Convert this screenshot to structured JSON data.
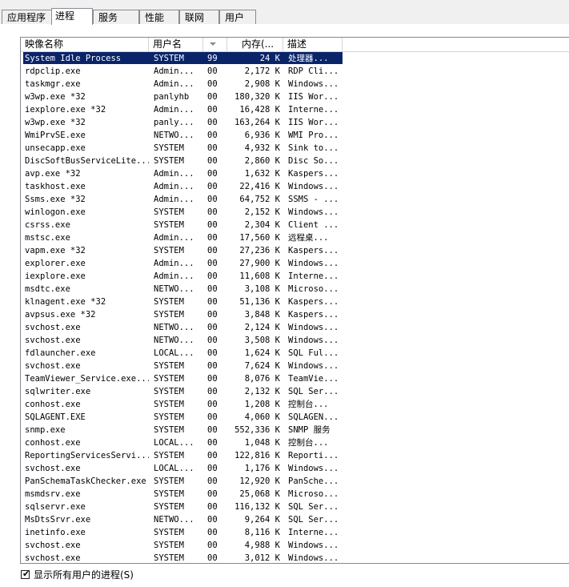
{
  "tabs": [
    {
      "label": "应用程序",
      "active": false
    },
    {
      "label": "进程",
      "active": true
    },
    {
      "label": "服务",
      "active": false
    },
    {
      "label": "性能",
      "active": false
    },
    {
      "label": "联网",
      "active": false
    },
    {
      "label": "用户",
      "active": false
    }
  ],
  "columns": {
    "name": "映像名称",
    "user": "用户名",
    "cpu": "",
    "memory": "内存(...",
    "description": "描述"
  },
  "processes": [
    {
      "name": "System Idle Process",
      "user": "SYSTEM",
      "cpu": "99",
      "memory": "24 K",
      "description": "处理器..."
    },
    {
      "name": "rdpclip.exe",
      "user": "Admin...",
      "cpu": "00",
      "memory": "2,172 K",
      "description": "RDP Cli..."
    },
    {
      "name": "taskmgr.exe",
      "user": "Admin...",
      "cpu": "00",
      "memory": "2,908 K",
      "description": "Windows..."
    },
    {
      "name": "w3wp.exe *32",
      "user": "panlyhb",
      "cpu": "00",
      "memory": "180,320 K",
      "description": "IIS Wor..."
    },
    {
      "name": "iexplore.exe *32",
      "user": "Admin...",
      "cpu": "00",
      "memory": "16,428 K",
      "description": "Interne..."
    },
    {
      "name": "w3wp.exe *32",
      "user": "panly...",
      "cpu": "00",
      "memory": "163,264 K",
      "description": "IIS Wor..."
    },
    {
      "name": "WmiPrvSE.exe",
      "user": "NETWO...",
      "cpu": "00",
      "memory": "6,936 K",
      "description": "WMI Pro..."
    },
    {
      "name": "unsecapp.exe",
      "user": "SYSTEM",
      "cpu": "00",
      "memory": "4,932 K",
      "description": "Sink to..."
    },
    {
      "name": "DiscSoftBusServiceLite...",
      "user": "SYSTEM",
      "cpu": "00",
      "memory": "2,860 K",
      "description": "Disc So..."
    },
    {
      "name": "avp.exe *32",
      "user": "Admin...",
      "cpu": "00",
      "memory": "1,632 K",
      "description": "Kaspers..."
    },
    {
      "name": "taskhost.exe",
      "user": "Admin...",
      "cpu": "00",
      "memory": "22,416 K",
      "description": "Windows..."
    },
    {
      "name": "Ssms.exe *32",
      "user": "Admin...",
      "cpu": "00",
      "memory": "64,752 K",
      "description": "SSMS - ..."
    },
    {
      "name": "winlogon.exe",
      "user": "SYSTEM",
      "cpu": "00",
      "memory": "2,152 K",
      "description": "Windows..."
    },
    {
      "name": "csrss.exe",
      "user": "SYSTEM",
      "cpu": "00",
      "memory": "2,304 K",
      "description": "Client ..."
    },
    {
      "name": "mstsc.exe",
      "user": "Admin...",
      "cpu": "00",
      "memory": "17,560 K",
      "description": "远程桌..."
    },
    {
      "name": "vapm.exe *32",
      "user": "SYSTEM",
      "cpu": "00",
      "memory": "27,236 K",
      "description": "Kaspers..."
    },
    {
      "name": "explorer.exe",
      "user": "Admin...",
      "cpu": "00",
      "memory": "27,900 K",
      "description": "Windows..."
    },
    {
      "name": "iexplore.exe",
      "user": "Admin...",
      "cpu": "00",
      "memory": "11,608 K",
      "description": "Interne..."
    },
    {
      "name": "msdtc.exe",
      "user": "NETWO...",
      "cpu": "00",
      "memory": "3,108 K",
      "description": "Microso..."
    },
    {
      "name": "klnagent.exe *32",
      "user": "SYSTEM",
      "cpu": "00",
      "memory": "51,136 K",
      "description": "Kaspers..."
    },
    {
      "name": "avpsus.exe *32",
      "user": "SYSTEM",
      "cpu": "00",
      "memory": "3,848 K",
      "description": "Kaspers..."
    },
    {
      "name": "svchost.exe",
      "user": "NETWO...",
      "cpu": "00",
      "memory": "2,124 K",
      "description": "Windows..."
    },
    {
      "name": "svchost.exe",
      "user": "NETWO...",
      "cpu": "00",
      "memory": "3,508 K",
      "description": "Windows..."
    },
    {
      "name": "fdlauncher.exe",
      "user": "LOCAL...",
      "cpu": "00",
      "memory": "1,624 K",
      "description": "SQL Ful..."
    },
    {
      "name": "svchost.exe",
      "user": "SYSTEM",
      "cpu": "00",
      "memory": "7,624 K",
      "description": "Windows..."
    },
    {
      "name": "TeamViewer_Service.exe...",
      "user": "SYSTEM",
      "cpu": "00",
      "memory": "8,076 K",
      "description": "TeamVie..."
    },
    {
      "name": "sqlwriter.exe",
      "user": "SYSTEM",
      "cpu": "00",
      "memory": "2,132 K",
      "description": "SQL Ser..."
    },
    {
      "name": "conhost.exe",
      "user": "SYSTEM",
      "cpu": "00",
      "memory": "1,208 K",
      "description": "控制台..."
    },
    {
      "name": "SQLAGENT.EXE",
      "user": "SYSTEM",
      "cpu": "00",
      "memory": "4,060 K",
      "description": "SQLAGEN..."
    },
    {
      "name": "snmp.exe",
      "user": "SYSTEM",
      "cpu": "00",
      "memory": "552,336 K",
      "description": "SNMP 服务"
    },
    {
      "name": "conhost.exe",
      "user": "LOCAL...",
      "cpu": "00",
      "memory": "1,048 K",
      "description": "控制台..."
    },
    {
      "name": "ReportingServicesServi...",
      "user": "SYSTEM",
      "cpu": "00",
      "memory": "122,816 K",
      "description": "Reporti..."
    },
    {
      "name": "svchost.exe",
      "user": "LOCAL...",
      "cpu": "00",
      "memory": "1,176 K",
      "description": "Windows..."
    },
    {
      "name": "PanSchemaTaskChecker.exe",
      "user": "SYSTEM",
      "cpu": "00",
      "memory": "12,920 K",
      "description": "PanSche..."
    },
    {
      "name": "msmdsrv.exe",
      "user": "SYSTEM",
      "cpu": "00",
      "memory": "25,068 K",
      "description": "Microso..."
    },
    {
      "name": "sqlservr.exe",
      "user": "SYSTEM",
      "cpu": "00",
      "memory": "116,132 K",
      "description": "SQL Ser..."
    },
    {
      "name": "MsDtsSrvr.exe",
      "user": "NETWO...",
      "cpu": "00",
      "memory": "9,264 K",
      "description": "SQL Ser..."
    },
    {
      "name": "inetinfo.exe",
      "user": "SYSTEM",
      "cpu": "00",
      "memory": "8,116 K",
      "description": "Interne..."
    },
    {
      "name": "svchost.exe",
      "user": "SYSTEM",
      "cpu": "00",
      "memory": "4,988 K",
      "description": "Windows..."
    },
    {
      "name": "svchost.exe",
      "user": "SYSTEM",
      "cpu": "00",
      "memory": "3,012 K",
      "description": "Windows..."
    }
  ],
  "selected_index": 0,
  "show_all_users": {
    "label": "显示所有用户的进程(S)",
    "checked": true
  },
  "colors": {
    "selection": "#0a246a",
    "border": "#828790",
    "header_divider": "#d5d5d5"
  }
}
